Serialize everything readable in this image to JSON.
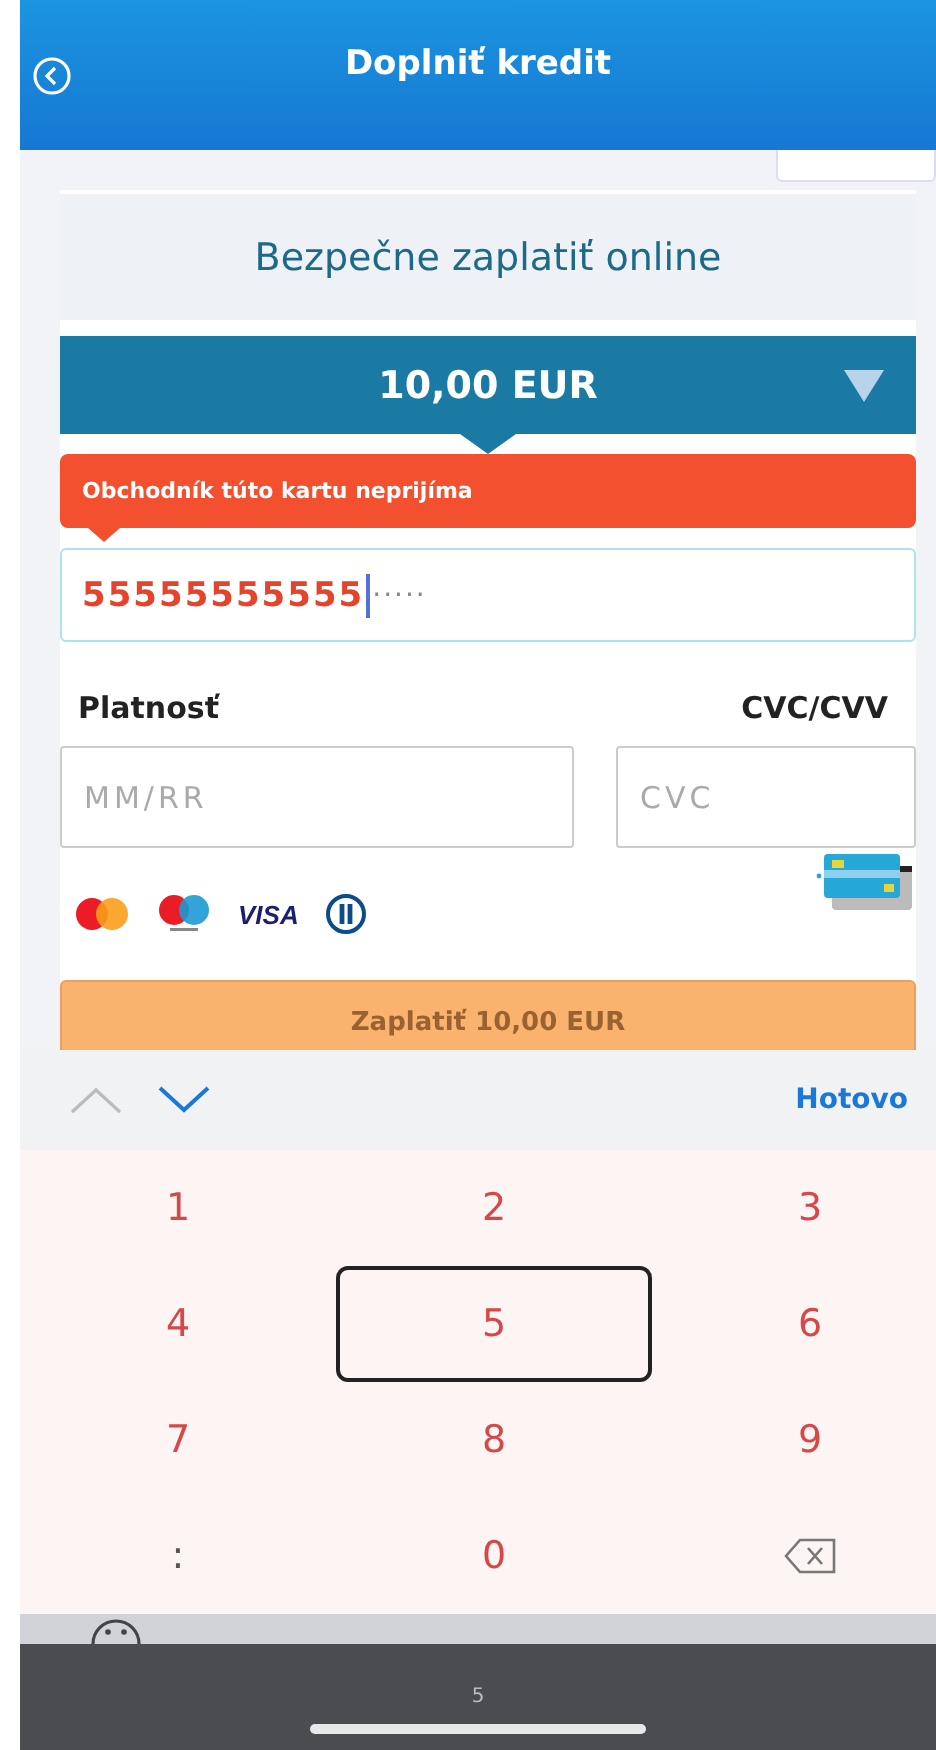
{
  "header": {
    "title": "Doplniť kredit"
  },
  "payment": {
    "heading": "Bezpečne zaplatiť online",
    "amount": "10,00 EUR",
    "error": "Obchodník túto kartu neprijíma",
    "card_number": {
      "value": "55555555555",
      "mask": "·····",
      "invalid": true
    },
    "expiry": {
      "label": "Platnosť",
      "placeholder": "MM/RR"
    },
    "cvc": {
      "label": "CVC/CVV",
      "placeholder": "CVC"
    },
    "pay_button": "Zaplatiť 10,00 EUR",
    "brand_text": "VISA"
  },
  "keyboard": {
    "toolbar": {
      "prev_disabled": true,
      "next_disabled": false,
      "done": "Hotovo"
    },
    "keys": [
      {
        "label": "1",
        "kind": "digit",
        "selected": false
      },
      {
        "label": "2",
        "kind": "digit",
        "selected": false
      },
      {
        "label": "3",
        "kind": "digit",
        "selected": false
      },
      {
        "label": "4",
        "kind": "digit",
        "selected": false
      },
      {
        "label": "5",
        "kind": "digit",
        "selected": true
      },
      {
        "label": "6",
        "kind": "digit",
        "selected": false
      },
      {
        "label": "7",
        "kind": "digit",
        "selected": false
      },
      {
        "label": "8",
        "kind": "digit",
        "selected": false
      },
      {
        "label": "9",
        "kind": "digit",
        "selected": false
      },
      {
        "label": ":",
        "kind": "symbol",
        "selected": false
      },
      {
        "label": "0",
        "kind": "digit",
        "selected": false
      },
      {
        "kind": "delete",
        "selected": false
      }
    ]
  },
  "bottom_bar": {
    "text": "5"
  }
}
